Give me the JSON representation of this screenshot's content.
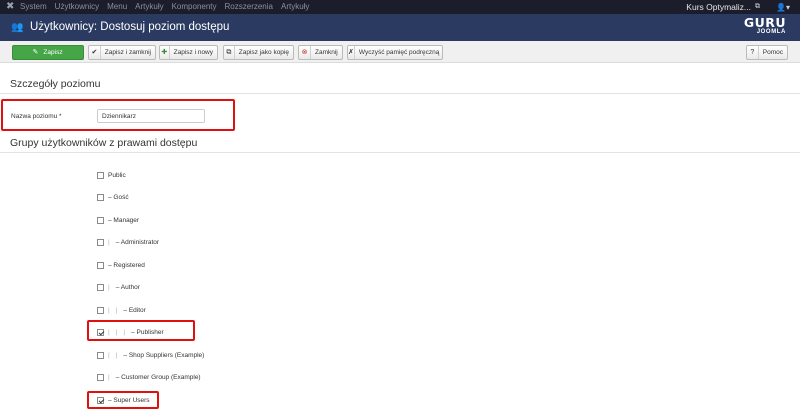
{
  "topbar": {
    "menu": [
      "System",
      "Użytkownicy",
      "Menu",
      "Artykuły",
      "Komponenty",
      "Rozszerzenia",
      "Artykuły"
    ],
    "site_name": "Kurs Optymaliz...",
    "user_icon": "user-icon"
  },
  "header": {
    "title": "Użytkownicy: Dostosuj poziom dostępu",
    "logo_line1": "GURU",
    "logo_line2": "JOOMLA"
  },
  "toolbar": {
    "save": "Zapisz",
    "save_close": "Zapisz i zamknij",
    "save_new": "Zapisz i nowy",
    "save_copy": "Zapisz jako kopię",
    "close": "Zamknij",
    "clear_cache": "Wyczyść pamięć podręczną",
    "help": "Pomoc"
  },
  "details": {
    "heading": "Szczegóły poziomu",
    "level_label": "Nazwa poziomu *",
    "level_value": "Dziennikarz"
  },
  "groups": {
    "heading": "Grupy użytkowników z prawami dostępu",
    "items": [
      {
        "label": "Public",
        "indent": 0,
        "checked": false
      },
      {
        "label": "– Gość",
        "indent": 0,
        "checked": false
      },
      {
        "label": "– Manager",
        "indent": 0,
        "checked": false
      },
      {
        "label": "– Administrator",
        "indent": 1,
        "checked": false
      },
      {
        "label": "– Registered",
        "indent": 0,
        "checked": false
      },
      {
        "label": "– Author",
        "indent": 1,
        "checked": false
      },
      {
        "label": "– Editor",
        "indent": 2,
        "checked": false
      },
      {
        "label": "– Publisher",
        "indent": 3,
        "checked": true
      },
      {
        "label": "– Shop Suppliers (Example)",
        "indent": 2,
        "checked": false
      },
      {
        "label": "– Customer Group (Example)",
        "indent": 1,
        "checked": false
      },
      {
        "label": "– Super Users",
        "indent": 0,
        "checked": true
      }
    ]
  },
  "colors": {
    "highlight": "#e01010",
    "header_bg": "#2b3a61",
    "topbar_bg": "#1b1d2a",
    "save_green": "#46a546"
  }
}
